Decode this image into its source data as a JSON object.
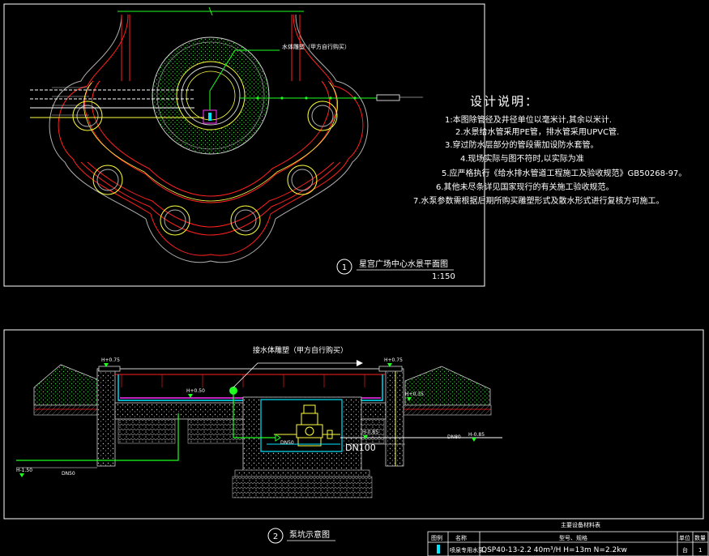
{
  "plan": {
    "title": "星宫广场中心水景平面图",
    "scale": "1:150",
    "number": "1",
    "callout_pump_room": "水体雕塑（甲方自行购买）"
  },
  "section": {
    "title": "泵坑示意图",
    "number": "2",
    "callout_sculpture": "接水体雕塑（甲方自行购买）",
    "levels": {
      "left_top": "H+0.75",
      "right_top": "H+0.75",
      "left_mid": "H+0.50",
      "right_mid": "H+0.35",
      "pit": "H-0.85",
      "right_low": "H-0.85",
      "bottom": "H-1.50"
    },
    "pipe_labels": {
      "left_drain": "DN50",
      "pump_in": "DN50",
      "pump_out": "DN100",
      "right_drain": "DN80"
    }
  },
  "notes": {
    "title": "设计说明：",
    "items": [
      "1:本图除管径及井径单位以毫米计,其余以米计.",
      "2.水景给水管采用PE管，排水管采用UPVC管.",
      "3.穿过防水层部分的管段需加设防水套管。",
      "4.现场实际与图不符时,以实际为准",
      "5.应严格执行《给水排水管道工程施工及验收规范》GB50268-97。",
      "6.其他未尽条详见国家现行的有关施工验收规范。",
      "7.水泵参数需根据后期所购买雕塑形式及散水形式进行复核方可施工。"
    ]
  },
  "equipment_table": {
    "title": "主要设备材料表",
    "headers": [
      "图例",
      "名称",
      "型号、规格",
      "单位",
      "数量"
    ],
    "rows": [
      [
        "",
        "喷泉专用水泵",
        "QSP40-13-2.2 40m³/H  H=13m N=2.2kw",
        "台",
        "1"
      ]
    ]
  },
  "colors": {
    "frame": "#ffffff",
    "red": "#ff2020",
    "yellow": "#ffff40",
    "cyan": "#00e5ff",
    "green": "#20ff20",
    "magenta": "#ff30ff",
    "hatch": "#c8c8c8"
  }
}
